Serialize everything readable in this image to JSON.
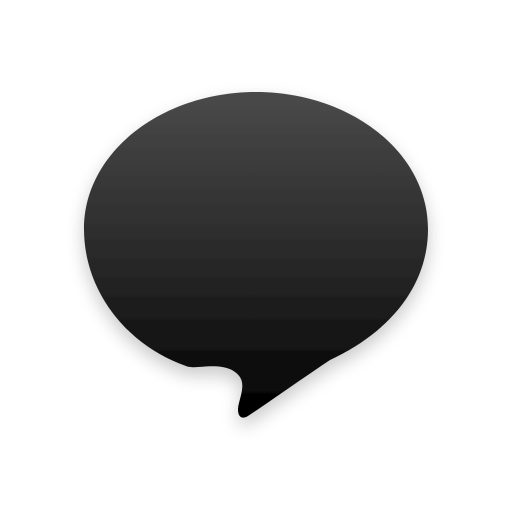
{
  "icon": {
    "name": "chat-bubble-icon",
    "gradient_top": "#4a4a4a",
    "gradient_bottom": "#000000"
  },
  "background": "#ffffff"
}
